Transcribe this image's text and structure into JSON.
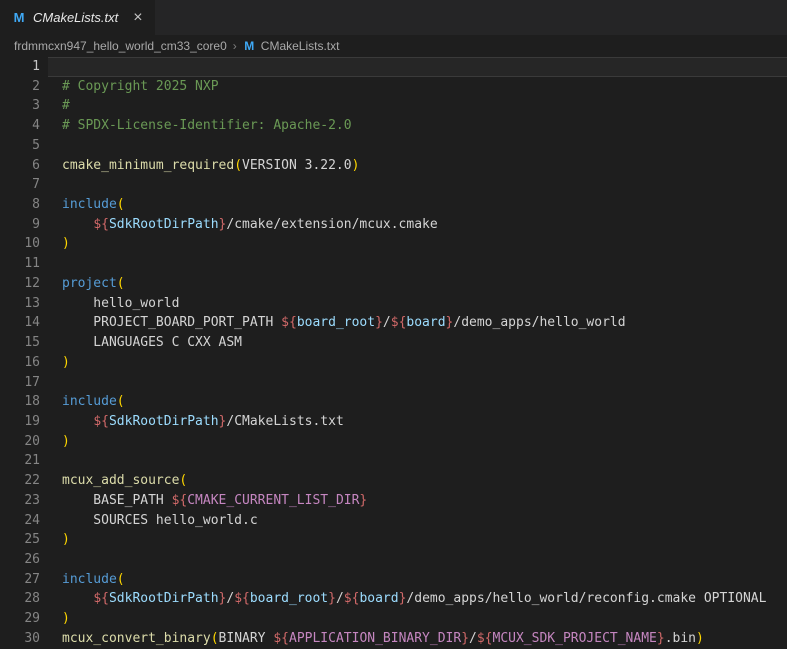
{
  "tab": {
    "icon": "M",
    "title": "CMakeLists.txt",
    "close_label": "×"
  },
  "breadcrumb": {
    "folder": "frdmmcxn947_hello_world_cm33_core0",
    "separator": "›",
    "file_icon": "M",
    "file": "CMakeLists.txt"
  },
  "colors": {
    "editor_background": "#1e1e1e",
    "tabbar_background": "#252526",
    "comment": "#6a9955",
    "function": "#dcdcaa",
    "keyword": "#569cd6",
    "variable": "#9cdcfe",
    "variable_delimiter": "#d16969",
    "builtin_variable": "#c586c0",
    "plain_text": "#d4d4d4",
    "bracket": "#ffd700",
    "line_number": "#858585",
    "active_line_number": "#c6c6c6",
    "file_icon_blue": "#3fa9f5"
  },
  "editor": {
    "lines": [
      {
        "n": 1,
        "active": true,
        "tokens": []
      },
      {
        "n": 2,
        "tokens": [
          {
            "t": "# Copyright 2025 NXP",
            "c": "comment"
          }
        ]
      },
      {
        "n": 3,
        "tokens": [
          {
            "t": "#",
            "c": "comment"
          }
        ]
      },
      {
        "n": 4,
        "tokens": [
          {
            "t": "# SPDX-License-Identifier: Apache-2.0",
            "c": "comment"
          }
        ]
      },
      {
        "n": 5,
        "tokens": []
      },
      {
        "n": 6,
        "tokens": [
          {
            "t": "cmake_minimum_required",
            "c": "fn"
          },
          {
            "t": "(",
            "c": "pa"
          },
          {
            "t": "VERSION 3.22.0",
            "c": "tx"
          },
          {
            "t": ")",
            "c": "pa"
          }
        ]
      },
      {
        "n": 7,
        "tokens": []
      },
      {
        "n": 8,
        "tokens": [
          {
            "t": "include",
            "c": "kw"
          },
          {
            "t": "(",
            "c": "pa"
          }
        ]
      },
      {
        "n": 9,
        "tokens": [
          {
            "t": "    ",
            "c": "tx"
          },
          {
            "t": "${",
            "c": "vd"
          },
          {
            "t": "SdkRootDirPath",
            "c": "var"
          },
          {
            "t": "}",
            "c": "vd"
          },
          {
            "t": "/cmake/extension/mcux.cmake",
            "c": "tx"
          }
        ]
      },
      {
        "n": 10,
        "tokens": [
          {
            "t": ")",
            "c": "pa"
          }
        ]
      },
      {
        "n": 11,
        "tokens": []
      },
      {
        "n": 12,
        "tokens": [
          {
            "t": "project",
            "c": "kw"
          },
          {
            "t": "(",
            "c": "pa"
          }
        ]
      },
      {
        "n": 13,
        "tokens": [
          {
            "t": "    hello_world",
            "c": "tx"
          }
        ]
      },
      {
        "n": 14,
        "tokens": [
          {
            "t": "    PROJECT_BOARD_PORT_PATH ",
            "c": "tx"
          },
          {
            "t": "${",
            "c": "vd"
          },
          {
            "t": "board_root",
            "c": "var"
          },
          {
            "t": "}",
            "c": "vd"
          },
          {
            "t": "/",
            "c": "tx"
          },
          {
            "t": "${",
            "c": "vd"
          },
          {
            "t": "board",
            "c": "var"
          },
          {
            "t": "}",
            "c": "vd"
          },
          {
            "t": "/demo_apps/hello_world",
            "c": "tx"
          }
        ]
      },
      {
        "n": 15,
        "tokens": [
          {
            "t": "    LANGUAGES C CXX ASM",
            "c": "tx"
          }
        ]
      },
      {
        "n": 16,
        "tokens": [
          {
            "t": ")",
            "c": "pa"
          }
        ]
      },
      {
        "n": 17,
        "tokens": []
      },
      {
        "n": 18,
        "tokens": [
          {
            "t": "include",
            "c": "kw"
          },
          {
            "t": "(",
            "c": "pa"
          }
        ]
      },
      {
        "n": 19,
        "tokens": [
          {
            "t": "    ",
            "c": "tx"
          },
          {
            "t": "${",
            "c": "vd"
          },
          {
            "t": "SdkRootDirPath",
            "c": "var"
          },
          {
            "t": "}",
            "c": "vd"
          },
          {
            "t": "/CMakeLists.txt",
            "c": "tx"
          }
        ]
      },
      {
        "n": 20,
        "tokens": [
          {
            "t": ")",
            "c": "pa"
          }
        ]
      },
      {
        "n": 21,
        "tokens": []
      },
      {
        "n": 22,
        "tokens": [
          {
            "t": "mcux_add_source",
            "c": "fn"
          },
          {
            "t": "(",
            "c": "pa"
          }
        ]
      },
      {
        "n": 23,
        "tokens": [
          {
            "t": "    BASE_PATH ",
            "c": "tx"
          },
          {
            "t": "${",
            "c": "vd"
          },
          {
            "t": "CMAKE_CURRENT_LIST_DIR",
            "c": "bi"
          },
          {
            "t": "}",
            "c": "vd"
          }
        ]
      },
      {
        "n": 24,
        "tokens": [
          {
            "t": "    SOURCES hello_world.c",
            "c": "tx"
          }
        ]
      },
      {
        "n": 25,
        "tokens": [
          {
            "t": ")",
            "c": "pa"
          }
        ]
      },
      {
        "n": 26,
        "tokens": []
      },
      {
        "n": 27,
        "tokens": [
          {
            "t": "include",
            "c": "kw"
          },
          {
            "t": "(",
            "c": "pa"
          }
        ]
      },
      {
        "n": 28,
        "tokens": [
          {
            "t": "    ",
            "c": "tx"
          },
          {
            "t": "${",
            "c": "vd"
          },
          {
            "t": "SdkRootDirPath",
            "c": "var"
          },
          {
            "t": "}",
            "c": "vd"
          },
          {
            "t": "/",
            "c": "tx"
          },
          {
            "t": "${",
            "c": "vd"
          },
          {
            "t": "board_root",
            "c": "var"
          },
          {
            "t": "}",
            "c": "vd"
          },
          {
            "t": "/",
            "c": "tx"
          },
          {
            "t": "${",
            "c": "vd"
          },
          {
            "t": "board",
            "c": "var"
          },
          {
            "t": "}",
            "c": "vd"
          },
          {
            "t": "/demo_apps/hello_world/reconfig.cmake OPTIONAL",
            "c": "tx"
          }
        ]
      },
      {
        "n": 29,
        "tokens": [
          {
            "t": ")",
            "c": "pa"
          }
        ]
      },
      {
        "n": 30,
        "tokens": [
          {
            "t": "mcux_convert_binary",
            "c": "fn"
          },
          {
            "t": "(",
            "c": "pa"
          },
          {
            "t": "BINARY ",
            "c": "tx"
          },
          {
            "t": "${",
            "c": "vd"
          },
          {
            "t": "APPLICATION_BINARY_DIR",
            "c": "bi"
          },
          {
            "t": "}",
            "c": "vd"
          },
          {
            "t": "/",
            "c": "tx"
          },
          {
            "t": "${",
            "c": "vd"
          },
          {
            "t": "MCUX_SDK_PROJECT_NAME",
            "c": "bi"
          },
          {
            "t": "}",
            "c": "vd"
          },
          {
            "t": ".bin",
            "c": "tx"
          },
          {
            "t": ")",
            "c": "pa"
          }
        ]
      }
    ]
  }
}
